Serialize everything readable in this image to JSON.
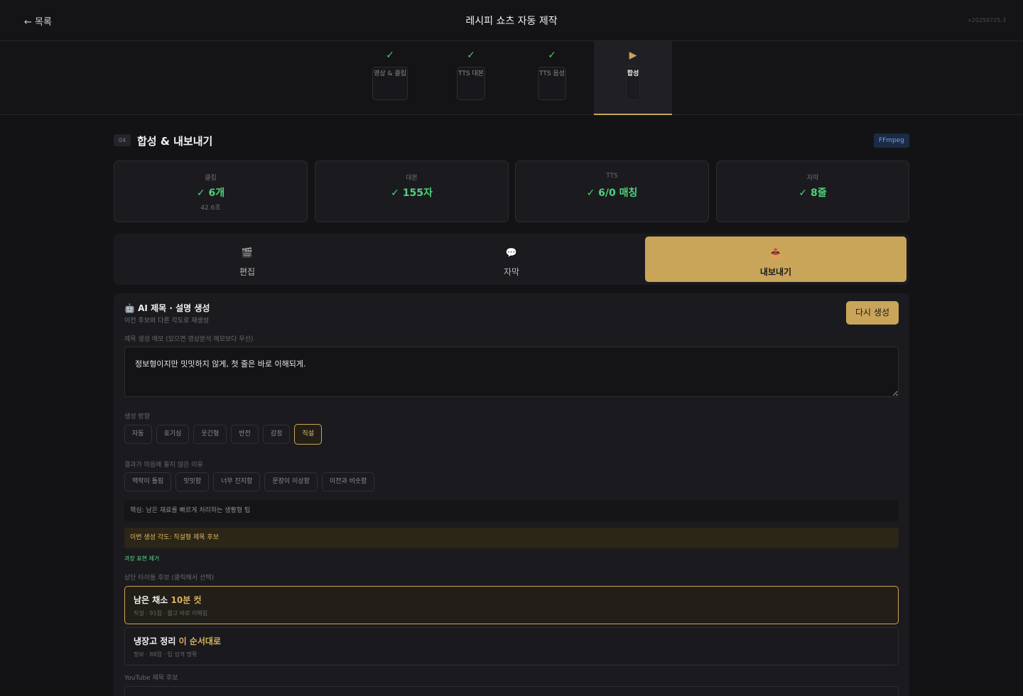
{
  "header": {
    "back_label": "← 목록",
    "title": "레시피 쇼츠 자동 제작",
    "version": "v20250725.3"
  },
  "steps": [
    {
      "mark": "✓",
      "label": "영상 & 클립"
    },
    {
      "mark": "✓",
      "label": "TTS 대본"
    },
    {
      "mark": "✓",
      "label": "TTS 음성"
    },
    {
      "mark": "▶",
      "label": "합성"
    }
  ],
  "section": {
    "number": "04",
    "title": "합성 & 내보내기",
    "badge": "FFmpeg"
  },
  "stats": [
    {
      "key": "클립",
      "value": "✓ 6개",
      "sub": "42.6초"
    },
    {
      "key": "대본",
      "value": "✓ 155자",
      "sub": ""
    },
    {
      "key": "TTS",
      "value": "✓ 6/0 매칭",
      "sub": ""
    },
    {
      "key": "자막",
      "value": "✓ 8줄",
      "sub": ""
    }
  ],
  "tabs": [
    {
      "icon": "🎬",
      "icon_name": "clapperboard-icon",
      "label": "편집"
    },
    {
      "icon": "💬",
      "icon_name": "speech-bubble-icon",
      "label": "자막"
    },
    {
      "icon": "📤",
      "icon_name": "outbox-icon",
      "label": "내보내기"
    }
  ],
  "ai": {
    "icon": "🤖",
    "title": "AI 제목 · 설명 생성",
    "subtitle": "이전 후보와 다른 각도로 재생성",
    "regen_label": "다시 생성",
    "memo_label": "제목 생성 메모 (있으면 영상분석 메모보다 우선)",
    "memo_value": "정보형이지만 밋밋하지 않게, 첫 줄은 바로 이해되게.",
    "direction_label": "생성 방향",
    "directions": [
      "자동",
      "호기심",
      "웃긴형",
      "반전",
      "감정",
      "직설"
    ],
    "direction_selected": "직설",
    "reason_label": "결과가 마음에 들지 않은 이유",
    "reasons": [
      "맥락이 틀림",
      "밋밋함",
      "너무 진지함",
      "문장이 이상함",
      "이전과 비슷함"
    ],
    "core": "핵심: 남은 재료를 빠르게 처리하는 생활형 팁",
    "angle": "이번 생성 각도: 직설형 제목 후보",
    "remove_note": "과장 표현 제거",
    "top_title_label": "상단 타이틀 후보 (클릭해서 선택)",
    "candidates": [
      {
        "plain": "남은 채소 ",
        "highlight": "10분 컷",
        "meta": "직설 · 91점 · 짧고 바로 이해됨"
      },
      {
        "plain": "냉장고 정리 ",
        "highlight": "이 순서대로",
        "meta": "정보 · 88점 · 팁 성격 명확"
      }
    ],
    "youtube_label": "YouTube 제목 후보"
  },
  "colors": {
    "accent": "#c9a55a",
    "success": "#4fd27a",
    "background": "#131316",
    "panel": "#1b1b1f"
  }
}
